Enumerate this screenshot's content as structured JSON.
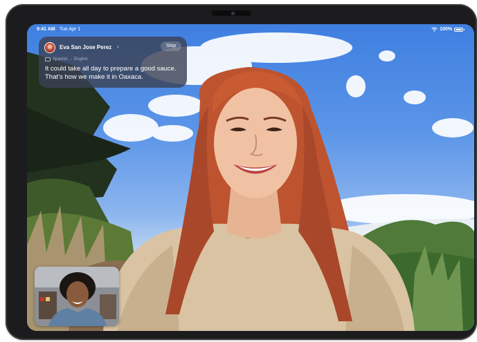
{
  "status_bar": {
    "time": "9:41 AM",
    "date": "Tue Apr 1",
    "battery": "100%",
    "icons": [
      "wifi-icon",
      "battery-icon"
    ]
  },
  "banner": {
    "caller_name": "Eva San Jose Perez",
    "chevron": "›",
    "stop_label": "Stop",
    "language_pair": "Spanish → English",
    "message": "It could take all day to prepare a good sauce. That’s how we make it in Oaxaca."
  },
  "colors": {
    "sky": "#4a86e4",
    "banner_bg": "#3a4256",
    "hair": "#c2552f",
    "sweater": "#dcc7a8",
    "device_frame": "#1c1c1e"
  }
}
